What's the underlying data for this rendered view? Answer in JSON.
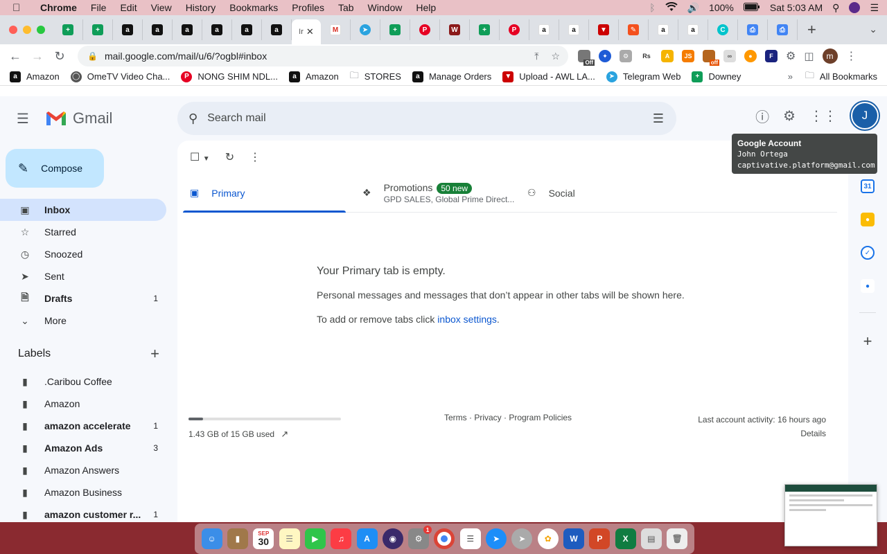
{
  "menubar": {
    "app": "Chrome",
    "items": [
      "File",
      "Edit",
      "View",
      "History",
      "Bookmarks",
      "Profiles",
      "Tab",
      "Window",
      "Help"
    ],
    "battery": "100%",
    "clock": "Sat 5:03 AM"
  },
  "browser": {
    "active_tab_label": "Ir",
    "url": "mail.google.com/mail/u/6/?ogbl#inbox",
    "profile_initial": "m",
    "ext_badge_1": "Off",
    "ext_badge_2": "off"
  },
  "bookmarks": {
    "items": [
      "Amazon",
      "OmeTV Video Cha...",
      "NONG SHIM NDL...",
      "Amazon",
      "STORES",
      "Manage Orders",
      "Upload - AWL LA...",
      "Telegram Web",
      "Downey"
    ],
    "all_label": "All Bookmarks"
  },
  "gmail": {
    "logo_text": "Gmail",
    "search_placeholder": "Search mail",
    "avatar_initial": "J",
    "tooltip": {
      "title": "Google Account",
      "name": "John Ortega",
      "email": "captivative.platform@gmail.com"
    },
    "compose_label": "Compose",
    "nav": [
      {
        "label": "Inbox",
        "count": ""
      },
      {
        "label": "Starred",
        "count": ""
      },
      {
        "label": "Snoozed",
        "count": ""
      },
      {
        "label": "Sent",
        "count": ""
      },
      {
        "label": "Drafts",
        "count": "1"
      },
      {
        "label": "More",
        "count": ""
      }
    ],
    "labels_title": "Labels",
    "labels": [
      {
        "label": ".Caribou Coffee",
        "count": ""
      },
      {
        "label": "Amazon",
        "count": ""
      },
      {
        "label": "amazon accelerate",
        "count": "1"
      },
      {
        "label": "Amazon Ads",
        "count": "3"
      },
      {
        "label": "Amazon Answers",
        "count": ""
      },
      {
        "label": "Amazon Business",
        "count": ""
      },
      {
        "label": "amazon customer r...",
        "count": "1"
      }
    ],
    "tabs": {
      "primary": "Primary",
      "promotions": "Promotions",
      "promotions_badge": "50 new",
      "promotions_sub": "GPD SALES, Global Prime Direct...",
      "social": "Social"
    },
    "empty": {
      "title": "Your Primary tab is empty.",
      "body": "Personal messages and messages that don’t appear in other tabs will be shown here.",
      "settings_prefix": "To add or remove tabs click ",
      "settings_link": "inbox settings",
      "settings_suffix": "."
    },
    "footer": {
      "storage": "1.43 GB of 15 GB used",
      "storage_fraction": 0.095,
      "policies": "Terms · Privacy · Program Policies",
      "activity": "Last account activity: 16 hours ago",
      "details": "Details"
    }
  },
  "dock": {
    "calendar_month": "SEP",
    "calendar_day": "30",
    "settings_badge": "1"
  },
  "colors": {
    "accent": "#0b57d0",
    "compose_bg": "#c2e7ff",
    "active_nav": "#d3e3fd",
    "promo_badge": "#188038"
  }
}
